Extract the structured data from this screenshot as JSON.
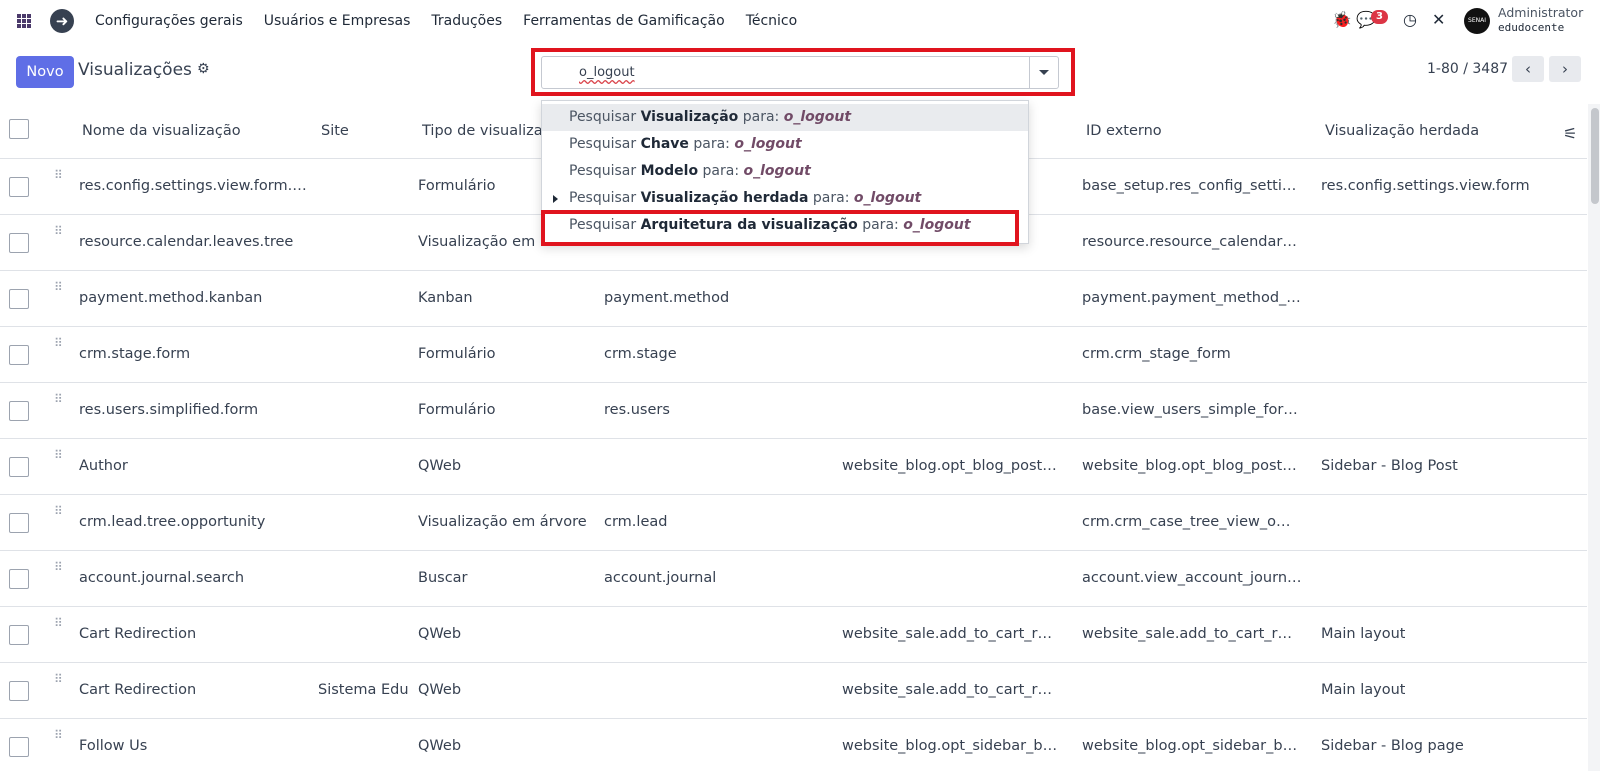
{
  "navbar": {
    "menu": [
      "Configurações gerais",
      "Usuários e Empresas",
      "Traduções",
      "Ferramentas de Gamificação",
      "Técnico"
    ],
    "messages_badge": "3",
    "user_name": "Administrator",
    "user_db": "edudocente",
    "avatar_text": "SENAI"
  },
  "control_panel": {
    "new_button": "Novo",
    "title": "Visualizações",
    "search_value": "o_logout",
    "pager_value": "1-80 / 3487"
  },
  "search_dropdown": {
    "items": [
      {
        "prefix": "Pesquisar ",
        "field": "Visualização",
        "mid": " para: ",
        "term": "o_logout"
      },
      {
        "prefix": "Pesquisar ",
        "field": "Chave",
        "mid": " para: ",
        "term": "o_logout"
      },
      {
        "prefix": "Pesquisar ",
        "field": "Modelo",
        "mid": " para: ",
        "term": "o_logout"
      },
      {
        "prefix": "Pesquisar ",
        "field": "Visualização herdada",
        "mid": " para: ",
        "term": "o_logout"
      },
      {
        "prefix": "Pesquisar ",
        "field": "Arquitetura da visualização",
        "mid": " para: ",
        "term": "o_logout"
      }
    ]
  },
  "table": {
    "headers": {
      "name": "Nome da visualização",
      "site": "Site",
      "type": "Tipo de visualização",
      "external_id": "ID externo",
      "inherited": "Visualização herdada"
    },
    "rows": [
      {
        "name": "res.config.settings.view.form.i…",
        "site": "",
        "type": "Formulário",
        "model": "",
        "key": "",
        "external_id": "base_setup.res_config_setti…",
        "inherited": "res.config.settings.view.form"
      },
      {
        "name": "resource.calendar.leaves.tree",
        "site": "",
        "type": "Visualização em",
        "model": "",
        "key": "",
        "external_id": "resource.resource_calendar…",
        "inherited": ""
      },
      {
        "name": "payment.method.kanban",
        "site": "",
        "type": "Kanban",
        "model": "payment.method",
        "key": "",
        "external_id": "payment.payment_method_…",
        "inherited": ""
      },
      {
        "name": "crm.stage.form",
        "site": "",
        "type": "Formulário",
        "model": "crm.stage",
        "key": "",
        "external_id": "crm.crm_stage_form",
        "inherited": ""
      },
      {
        "name": "res.users.simplified.form",
        "site": "",
        "type": "Formulário",
        "model": "res.users",
        "key": "",
        "external_id": "base.view_users_simple_for…",
        "inherited": ""
      },
      {
        "name": "Author",
        "site": "",
        "type": "QWeb",
        "model": "",
        "key": "website_blog.opt_blog_post…",
        "external_id": "website_blog.opt_blog_post…",
        "inherited": "Sidebar - Blog Post"
      },
      {
        "name": "crm.lead.tree.opportunity",
        "site": "",
        "type": "Visualização em árvore",
        "model": "crm.lead",
        "key": "",
        "external_id": "crm.crm_case_tree_view_o…",
        "inherited": ""
      },
      {
        "name": "account.journal.search",
        "site": "",
        "type": "Buscar",
        "model": "account.journal",
        "key": "",
        "external_id": "account.view_account_journ…",
        "inherited": ""
      },
      {
        "name": "Cart Redirection",
        "site": "",
        "type": "QWeb",
        "model": "",
        "key": "website_sale.add_to_cart_r…",
        "external_id": "website_sale.add_to_cart_r…",
        "inherited": "Main layout"
      },
      {
        "name": "Cart Redirection",
        "site": "Sistema Edu",
        "type": "QWeb",
        "model": "",
        "key": "website_sale.add_to_cart_r…",
        "external_id": "",
        "inherited": "Main layout"
      },
      {
        "name": "Follow Us",
        "site": "",
        "type": "QWeb",
        "model": "",
        "key": "website_blog.opt_sidebar_b…",
        "external_id": "website_blog.opt_sidebar_b…",
        "inherited": "Sidebar - Blog page"
      }
    ]
  }
}
